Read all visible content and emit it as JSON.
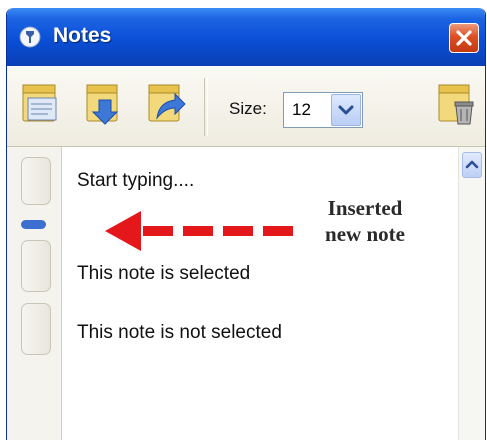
{
  "window": {
    "title": "Notes",
    "app_icon": "notes-app-icon",
    "close_icon": "close-icon",
    "accent": "#0a4fd6",
    "close_color": "#dd4e22"
  },
  "toolbar": {
    "buttons": [
      {
        "icon": "new-note-icon"
      },
      {
        "icon": "import-note-icon"
      },
      {
        "icon": "export-note-icon"
      },
      {
        "icon": "delete-note-icon"
      }
    ],
    "size_label": "Size:",
    "size_value": "12",
    "dropdown_icon": "chevron-down-icon"
  },
  "notes": [
    {
      "text": "Start typing....",
      "state": "new"
    },
    {
      "text": "This note is selected",
      "state": "selected"
    },
    {
      "text": "This note is not selected",
      "state": "normal"
    }
  ],
  "annotation": {
    "line1": "Inserted",
    "line2": "new note",
    "arrow_color": "#e4171b"
  },
  "scrollbar": {
    "up_icon": "scroll-up-icon"
  }
}
